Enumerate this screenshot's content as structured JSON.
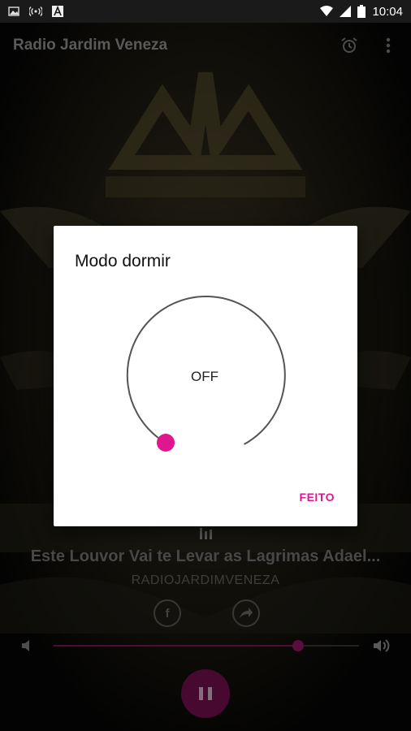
{
  "status_bar": {
    "time": "10:04",
    "left_icons": [
      "image-icon",
      "broadcast-icon",
      "app-a-icon"
    ],
    "right_icons": [
      "wifi-icon",
      "signal-icon",
      "battery-icon"
    ]
  },
  "app_bar": {
    "title": "Radio Jardim Veneza",
    "actions": [
      "alarm-clock-icon",
      "more-vert-icon"
    ]
  },
  "player": {
    "track_title": "Este Louvor Vai te Levar as Lagrimas Adael...",
    "artist": "RADIOJARDIMVENEZA",
    "share_facebook_glyph": "f",
    "volume_fraction": 0.8,
    "state": "playing"
  },
  "dialog": {
    "title": "Modo dormir",
    "dial_value": "OFF",
    "done_label": "FEITO",
    "accent_color": "#e0168e"
  },
  "colors": {
    "accent": "#e0168e",
    "play_button": "#6e0f49"
  }
}
